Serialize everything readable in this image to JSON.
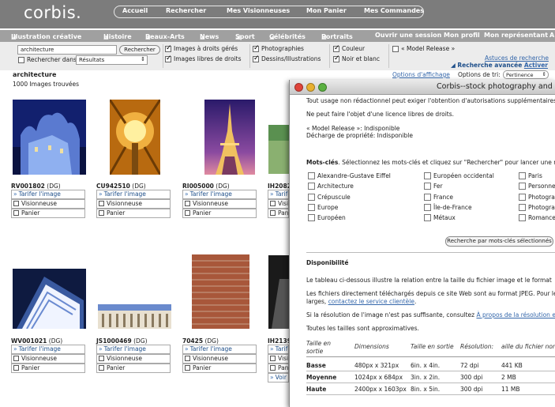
{
  "brand": {
    "logo_text": "corbis."
  },
  "top_nav": [
    "Accueil",
    "Rechercher",
    "Mes Visionneuses",
    "Mon Panier",
    "Mes Commandes"
  ],
  "category_nav": [
    "Illustration créative",
    "Histoire",
    "Beaux-Arts",
    "News",
    "Sport",
    "Célébrités",
    "Portraits"
  ],
  "account_nav": [
    "Ouvrir une session",
    "Mon profil",
    "Mon représentant",
    "A"
  ],
  "search": {
    "query": "architecture",
    "button": "Rechercher",
    "search_within_label": "Rechercher dans",
    "search_within_value": "Résultats",
    "filters": [
      {
        "label": "Images à droits gérés",
        "checked": true
      },
      {
        "label": "Images libres de droits",
        "checked": true
      },
      {
        "label": "Photographies",
        "checked": true
      },
      {
        "label": "Dessins/Illustrations",
        "checked": true
      },
      {
        "label": "Couleur",
        "checked": true
      },
      {
        "label": "Noir et blanc",
        "checked": true
      },
      {
        "label": "« Model Release »",
        "checked": false
      }
    ],
    "links": {
      "search_tips": "Astuces de recherche",
      "advanced": "Recherche avancée",
      "activate": "Activer"
    }
  },
  "results": {
    "term": "architecture",
    "count_text": "1000 Images trouvées",
    "display_options": "Options d'affichage",
    "sort_label": "Options de tri:",
    "sort_value": "Pertinence"
  },
  "card_labels": {
    "price": "Tarifer l'image",
    "lightbox": "Visionneuse",
    "cart": "Panier",
    "view": "Voir l"
  },
  "cards": [
    {
      "id": "RV001802",
      "type": "(DG)"
    },
    {
      "id": "CU942510",
      "type": "(DG)"
    },
    {
      "id": "RI005000",
      "type": "(DG)"
    },
    {
      "id": "IH2082",
      "type": ""
    },
    {
      "id": "WV001021",
      "type": "(DG)"
    },
    {
      "id": "JS1000469",
      "type": "(DG)"
    },
    {
      "id": "70425",
      "type": "(DG)"
    },
    {
      "id": "IH2139",
      "type": ""
    }
  ],
  "modal": {
    "title": "Corbis--stock photography and",
    "usage_note": "Tout usage non rédactionnel peut exiger l'obtention d'autorisations supplémentaires.",
    "license_note": "Ne peut faire l'objet d'une licence libres de droits.",
    "model_release": "« Model Release »: Indisponible",
    "property_release": "Décharge de propriété: Indisponible",
    "keywords_heading": "Mots-clés",
    "keywords_instructions": ". Sélectionnez les mots-clés et cliquez sur \"Rechercher\" pour lancer une re",
    "keywords": [
      [
        "Alexandre-Gustave Eiffel",
        "Européen occidental",
        "Paris"
      ],
      [
        "Architecture",
        "Fer",
        "Personne"
      ],
      [
        "Crépuscule",
        "France",
        "Photograp"
      ],
      [
        "Europe",
        "Île-de-France",
        "Photograp"
      ],
      [
        "Européen",
        "Métaux",
        "Romance"
      ]
    ],
    "keyword_search_button": "Recherche par mots-clés sélectionnés",
    "availability_heading": "Disponibilité",
    "availability_text": "Le tableau ci-dessous illustre la relation entre la taille du fichier image et le format",
    "jpeg_text_1": "Les fichiers directement téléchargés depuis ce site Web sont au format JPEG. Pour le",
    "jpeg_text_2_prefix": "larges, ",
    "jpeg_text_2_link": "contactez le service clientèle",
    "jpeg_text_2_suffix": ".",
    "resolution_prefix": "Si la résolution de l'image n'est pas suffisante, consultez ",
    "resolution_link": "À propos de la résolution e",
    "approx_note": "Toutes les tailles sont approximatives.",
    "table_headers": [
      "Taille en sortie",
      "Dimensions",
      "Taille en sortie",
      "Résolution:",
      "aille du fichier non"
    ],
    "table_rows": [
      [
        "Basse",
        "480px x 321px",
        "6in. x 4in.",
        "72 dpi",
        "441 KB"
      ],
      [
        "Moyenne",
        "1024px x 684px",
        "3in. x 2in.",
        "300 dpi",
        "2 MB"
      ],
      [
        "Haute",
        "2400px x 1603px",
        "8in. x 5in.",
        "300 dpi",
        "11 MB"
      ]
    ]
  }
}
